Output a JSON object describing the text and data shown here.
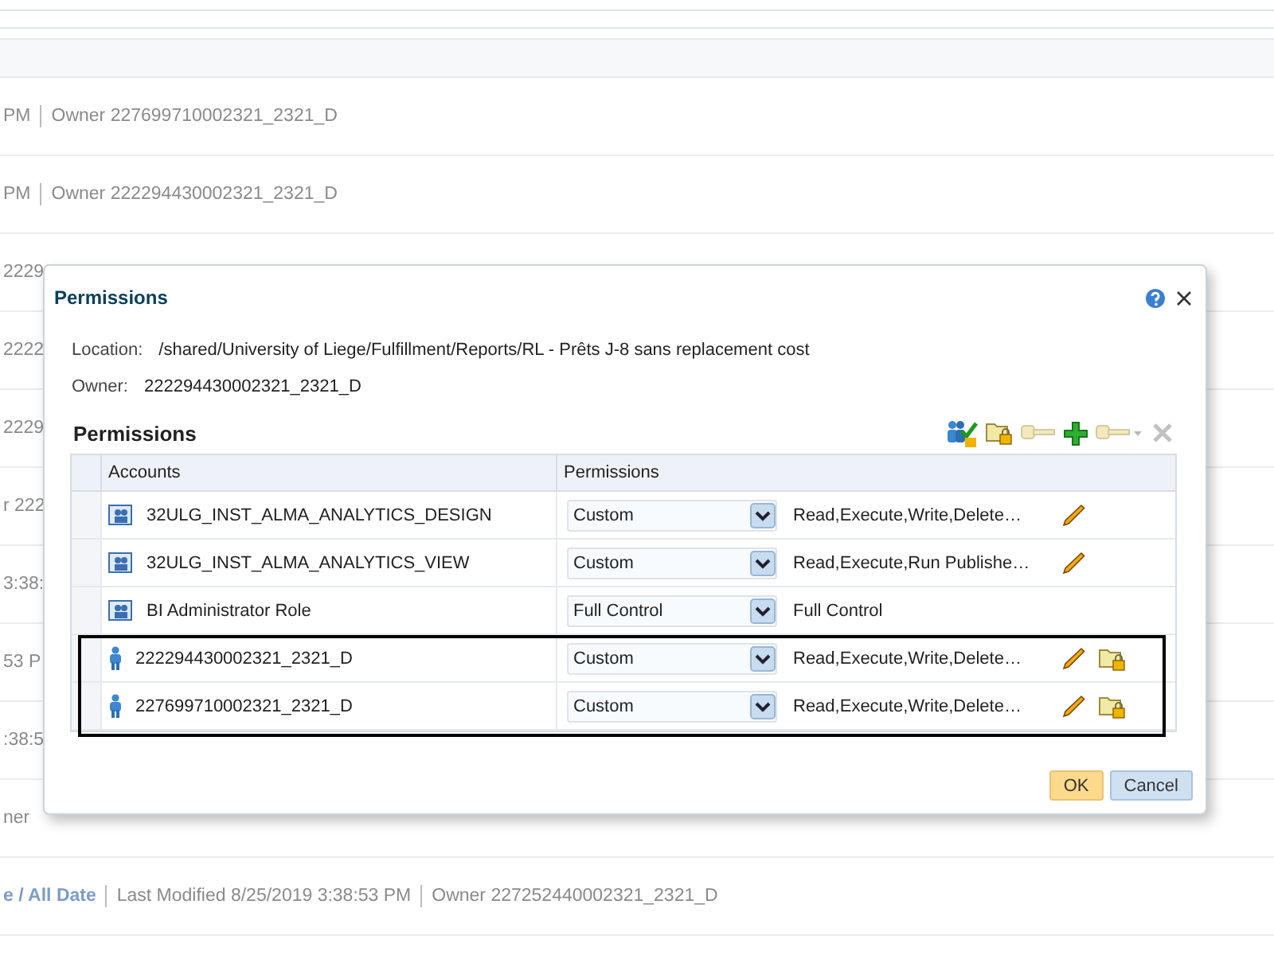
{
  "background": {
    "rows": [
      {
        "parts": [
          "PM",
          "Owner 227699710002321_2321_D"
        ]
      },
      {
        "parts": [
          "PM",
          "Owner 222294430002321_2321_D"
        ]
      },
      {
        "parts": [
          "2229"
        ]
      },
      {
        "parts": [
          "2222"
        ]
      },
      {
        "parts": [
          "2229"
        ]
      },
      {
        "parts": [
          "r 222"
        ]
      },
      {
        "parts": [
          "3:38:"
        ]
      },
      {
        "parts": [
          "53 P"
        ]
      },
      {
        "parts": [
          ":38:5"
        ]
      },
      {
        "parts": [
          "ner"
        ]
      },
      {
        "link": "e / All Date",
        "parts": [
          "Last Modified 8/25/2019 3:38:53 PM",
          "Owner 227252440002321_2321_D"
        ]
      }
    ]
  },
  "dialog": {
    "title": "Permissions",
    "location_label": "Location:",
    "location": "/shared/University of Liege/Fulfillment/Reports/RL - Prêts J-8 sans replacement cost",
    "owner_label": "Owner:",
    "owner": "222294430002321_2321_D",
    "section_title": "Permissions",
    "toolbar": [
      {
        "kind": "users",
        "disabled": false
      },
      {
        "kind": "folder",
        "disabled": false
      },
      {
        "kind": "key",
        "disabled": true
      },
      {
        "kind": "add",
        "disabled": false
      },
      {
        "kind": "keymenu",
        "disabled": true
      },
      {
        "kind": "delete",
        "disabled": true
      }
    ],
    "columns": [
      "Accounts",
      "Permissions"
    ],
    "rows": [
      {
        "kind": "role",
        "account": "32ULG_INST_ALMA_ANALYTICS_DESIGN",
        "permission": "Custom",
        "summary": "Read,Execute,Write,Delete…",
        "editable": true,
        "owner_icon": false,
        "highlighted": false
      },
      {
        "kind": "role",
        "account": "32ULG_INST_ALMA_ANALYTICS_VIEW",
        "permission": "Custom",
        "summary": "Read,Execute,Run Publishe…",
        "editable": true,
        "owner_icon": false,
        "highlighted": false
      },
      {
        "kind": "role",
        "account": "BI Administrator Role",
        "permission": "Full Control",
        "summary": "Full Control",
        "editable": false,
        "owner_icon": false,
        "highlighted": false
      },
      {
        "kind": "user",
        "account": "222294430002321_2321_D",
        "permission": "Custom",
        "summary": "Read,Execute,Write,Delete…",
        "editable": true,
        "owner_icon": true,
        "highlighted": true
      },
      {
        "kind": "user",
        "account": "227699710002321_2321_D",
        "permission": "Custom",
        "summary": "Read,Execute,Write,Delete…",
        "editable": true,
        "owner_icon": true,
        "highlighted": true
      }
    ],
    "buttons": [
      {
        "label": "OK",
        "kind": "primary"
      },
      {
        "label": "Cancel",
        "kind": "secondary"
      }
    ]
  }
}
